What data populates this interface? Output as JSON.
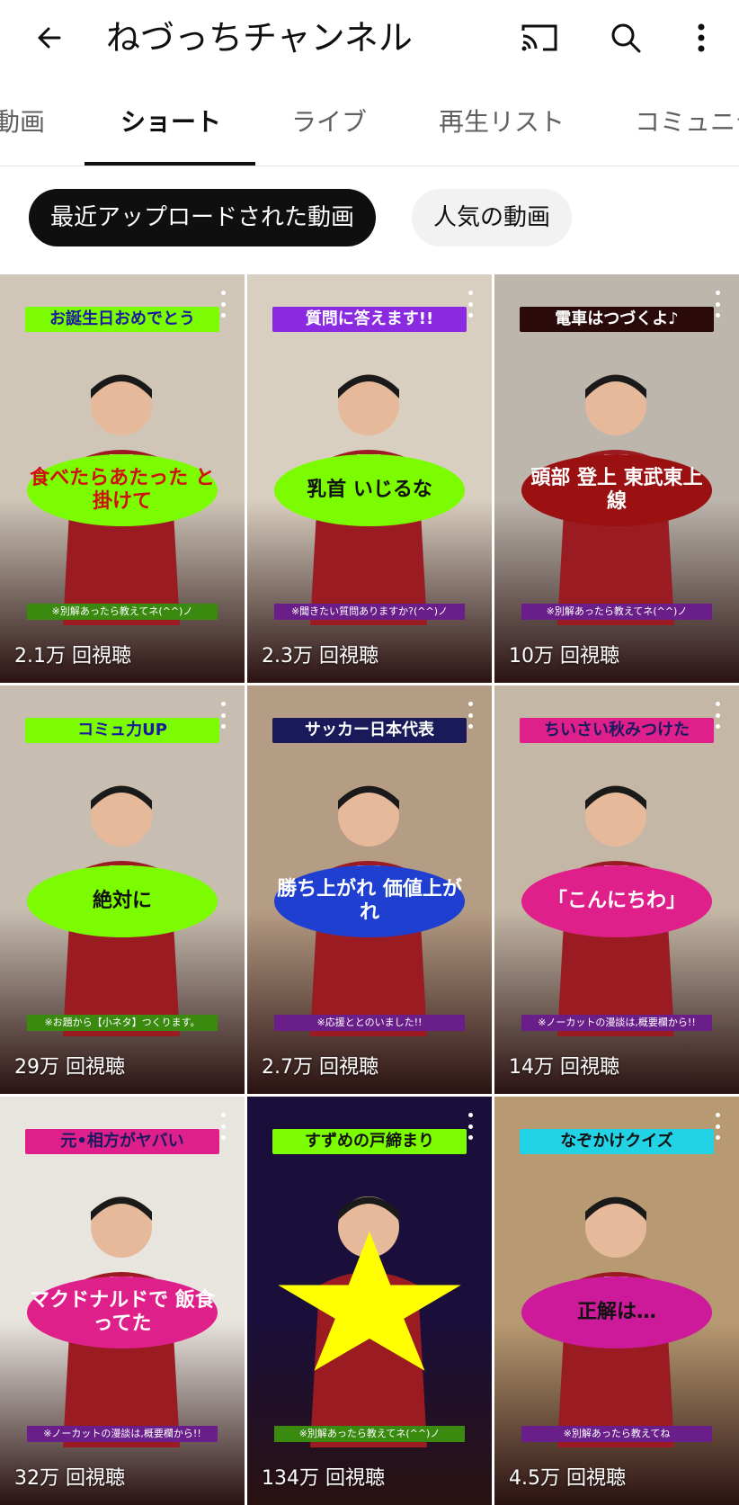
{
  "header": {
    "title": "ねづっちチャンネル",
    "icons": [
      "back-arrow-icon",
      "cast-icon",
      "search-icon",
      "more-vert-icon"
    ]
  },
  "tabs": [
    {
      "label": "動画",
      "active": false
    },
    {
      "label": "ショート",
      "active": true
    },
    {
      "label": "ライブ",
      "active": false
    },
    {
      "label": "再生リスト",
      "active": false
    },
    {
      "label": "コミュニテ",
      "active": false
    }
  ],
  "chips": [
    {
      "label": "最近アップロードされた動画",
      "selected": true
    },
    {
      "label": "人気の動画",
      "selected": false
    }
  ],
  "shorts": [
    {
      "caption": "お誕生日おめでとう",
      "bubble": "食べたらあたった と掛けて",
      "strip": "※別解あったら教えてネ(^^)ノ",
      "views": "2.1万 回視聴",
      "bg": "#cfc6b8",
      "captionBg": "#7cfc00",
      "captionColor": "#1a1aa0",
      "bubbleBg": "#7cfc00",
      "bubbleColor": "#d01010"
    },
    {
      "caption": "質問に答えます!!",
      "bubble": "乳首 いじるな",
      "strip": "※聞きたい質問ありますか?(^^)ノ",
      "views": "2.3万 回視聴",
      "bg": "#d9cfc0",
      "captionBg": "#8a2be2",
      "captionColor": "#ffffff",
      "bubbleBg": "#7cfc00",
      "bubbleColor": "#111111"
    },
    {
      "caption": "電車はつづくよ♪",
      "bubble": "頭部 登上 東武東上線",
      "strip": "※別解あったら教えてネ(^^)ノ",
      "views": "10万 回視聴",
      "bg": "#bdb6ad",
      "captionBg": "#2a0a0a",
      "captionColor": "#ffffff",
      "bubbleBg": "#9b1111",
      "bubbleColor": "#ffffff"
    },
    {
      "caption": "コミュ力UP",
      "bubble": "絶対に",
      "strip": "※お題から【小ネタ】つくります。",
      "views": "29万 回視聴",
      "bg": "#c7bdb0",
      "captionBg": "#7cfc00",
      "captionColor": "#1a1aa0",
      "bubbleBg": "#7cfc00",
      "bubbleColor": "#111111"
    },
    {
      "caption": "サッカー日本代表",
      "bubble": "勝ち上がれ 価値上がれ",
      "strip": "※応援ととのいました!!",
      "views": "2.7万 回視聴",
      "bg": "#b59c84",
      "captionBg": "#1a1a5a",
      "captionColor": "#ffffff",
      "bubbleBg": "#1e3fd0",
      "bubbleColor": "#ffffff"
    },
    {
      "caption": "ちいさい秋みつけた",
      "bubble": "「こんにちわ」",
      "strip": "※ノーカットの漫談は,概要欄から!!",
      "views": "14万 回視聴",
      "bg": "#c4b7a6",
      "captionBg": "#e0208a",
      "captionColor": "#1a1a60",
      "bubbleBg": "#e0208a",
      "bubbleColor": "#ffffff"
    },
    {
      "caption": "元•相方がヤバい",
      "bubble": "マクドナルドで 飯食ってた",
      "strip": "※ノーカットの漫談は,概要欄から!!",
      "views": "32万 回視聴",
      "bg": "#e8e4de",
      "captionBg": "#e0208a",
      "captionColor": "#1a1a60",
      "bubbleBg": "#e0208a",
      "bubbleColor": "#ffffff"
    },
    {
      "caption": "すずめの戸締まり",
      "bubble": "",
      "strip": "※別解あったら教えてネ(^^)ノ",
      "views": "134万 回視聴",
      "bg": "#1a0f3a",
      "captionBg": "#7cfc00",
      "captionColor": "#111111",
      "bubbleBg": "#ffff00",
      "bubbleColor": "#111111"
    },
    {
      "caption": "なぞかけクイズ",
      "bubble": "正解は…",
      "strip": "※別解あったら教えてね",
      "views": "4.5万 回視聴",
      "bg": "#b89a72",
      "captionBg": "#22d3e6",
      "captionColor": "#111111",
      "bubbleBg": "#cc1a9a",
      "bubbleColor": "#111111"
    }
  ]
}
